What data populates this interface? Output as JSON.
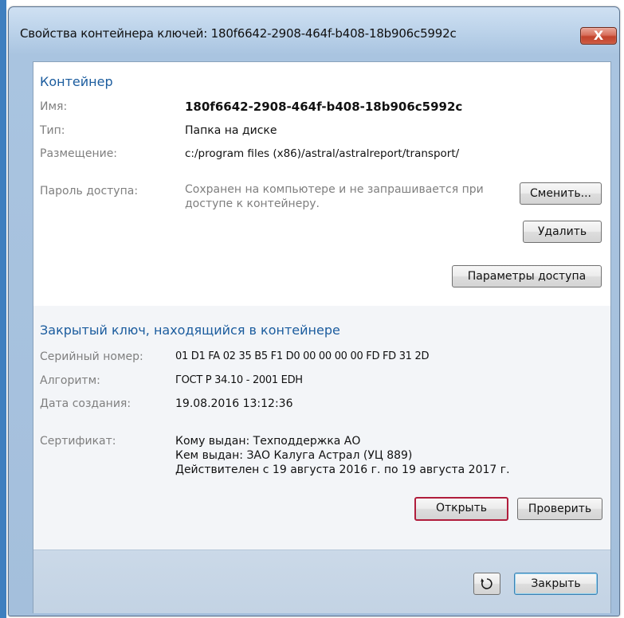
{
  "window": {
    "title": "Свойства контейнера ключей: 180f6642-2908-464f-b408-18b906c5992c",
    "close_glyph": "X"
  },
  "container": {
    "heading": "Контейнер",
    "name_label": "Имя:",
    "name_value": "180f6642-2908-464f-b408-18b906c5992c",
    "type_label": "Тип:",
    "type_value": "Папка на диске",
    "location_label": "Размещение:",
    "location_value": "c:/program files (x86)/astral/astralreport/transport/",
    "password_label": "Пароль доступа:",
    "password_line1": "Сохранен на компьютере и не запрашивается при",
    "password_line2": "доступе к контейнеру.",
    "change_button": "Сменить...",
    "delete_button": "Удалить",
    "access_params_button": "Параметры доступа"
  },
  "private_key": {
    "heading": "Закрытый ключ, находящийся в контейнере",
    "serial_label": "Серийный номер:",
    "serial_value": "01 D1 FA 02 35 B5 F1 D0 00 00 00 00 FD FD 31 2D",
    "algorithm_label": "Алгоритм:",
    "algorithm_value": "ГОСТ Р 34.10 - 2001 EDH",
    "created_label": "Дата создания:",
    "created_value": "19.08.2016 13:12:36",
    "certificate_label": "Сертификат:",
    "issued_to": "Кому выдан: Техподдержка АО",
    "issued_by": "Кем выдан: ЗАО Калуга Астрал (УЦ 889)",
    "validity": "Действителен с 19 августа 2016 г. по 19 августа 2017 г.",
    "open_button": "Открыть",
    "verify_button": "Проверить"
  },
  "footer": {
    "refresh_icon": "refresh-icon",
    "close_button": "Закрыть"
  },
  "colors": {
    "heading": "#1b5c9e",
    "label": "#7f7f7f",
    "focus_border": "#b01d3c",
    "close_button_red": "#c2432c"
  }
}
